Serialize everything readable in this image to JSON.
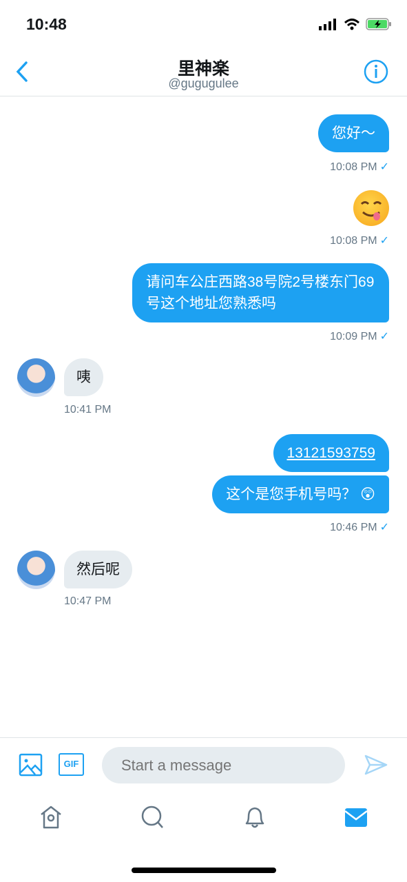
{
  "status": {
    "time": "10:48"
  },
  "header": {
    "title": "里神楽",
    "handle": "@gugugulee"
  },
  "messages": [
    {
      "dir": "out",
      "text": "您好～",
      "time": "10:08 PM"
    },
    {
      "dir": "out",
      "emoji": "yum-face",
      "time": "10:08 PM"
    },
    {
      "dir": "out",
      "text": "请问车公庄西路38号院2号楼东门69号这个地址您熟悉吗",
      "time": "10:09 PM"
    },
    {
      "dir": "in",
      "text": "咦",
      "time": "10:41 PM"
    },
    {
      "dir": "out",
      "text": "13121593759",
      "time": ""
    },
    {
      "dir": "out",
      "text": "这个是您手机号吗？",
      "emoji": "😲",
      "time": "10:46 PM"
    },
    {
      "dir": "in",
      "text": "然后呢",
      "time": "10:47 PM"
    }
  ],
  "check": "✓",
  "compose": {
    "placeholder": "Start a message",
    "gif": "GIF"
  },
  "colors": {
    "accent": "#1da1f2",
    "incoming": "#e6ecf0"
  }
}
